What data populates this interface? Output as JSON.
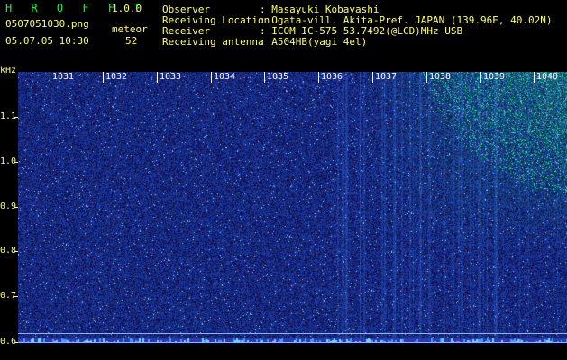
{
  "app": {
    "name": "H R O F F T",
    "version": "1.0.0"
  },
  "file": {
    "name": "0507051030.png",
    "datetime": "05.07.05 10:30"
  },
  "counter": {
    "label": "meteor",
    "value": "52"
  },
  "info": [
    {
      "label": "Observer",
      "value": ": Masayuki Kobayashi"
    },
    {
      "label": "Receiving Location",
      "value": ": Ogata-vill. Akita-Pref. JAPAN (139.96E, 40.02N)"
    },
    {
      "label": "Receiver",
      "value": ": ICOM IC-575 53.7492(@LCD)MHz USB"
    },
    {
      "label": "Receiving antenna",
      "value": ": A504HB(yagi 4el)"
    }
  ],
  "axis": {
    "y_unit": "kHz",
    "y_ticks": [
      "1.1",
      "1.0",
      "0.9",
      "0.8",
      "0.7",
      "0.6"
    ],
    "time_ticks": [
      "1031",
      "1032",
      "1033",
      "1034",
      "1035",
      "1036",
      "1037",
      "1038",
      "1039",
      "1040"
    ]
  },
  "colors": {
    "background": "#000000",
    "text": "#ffff66",
    "title": "#22ee44",
    "spectrum_base": "#1a2a8a"
  }
}
